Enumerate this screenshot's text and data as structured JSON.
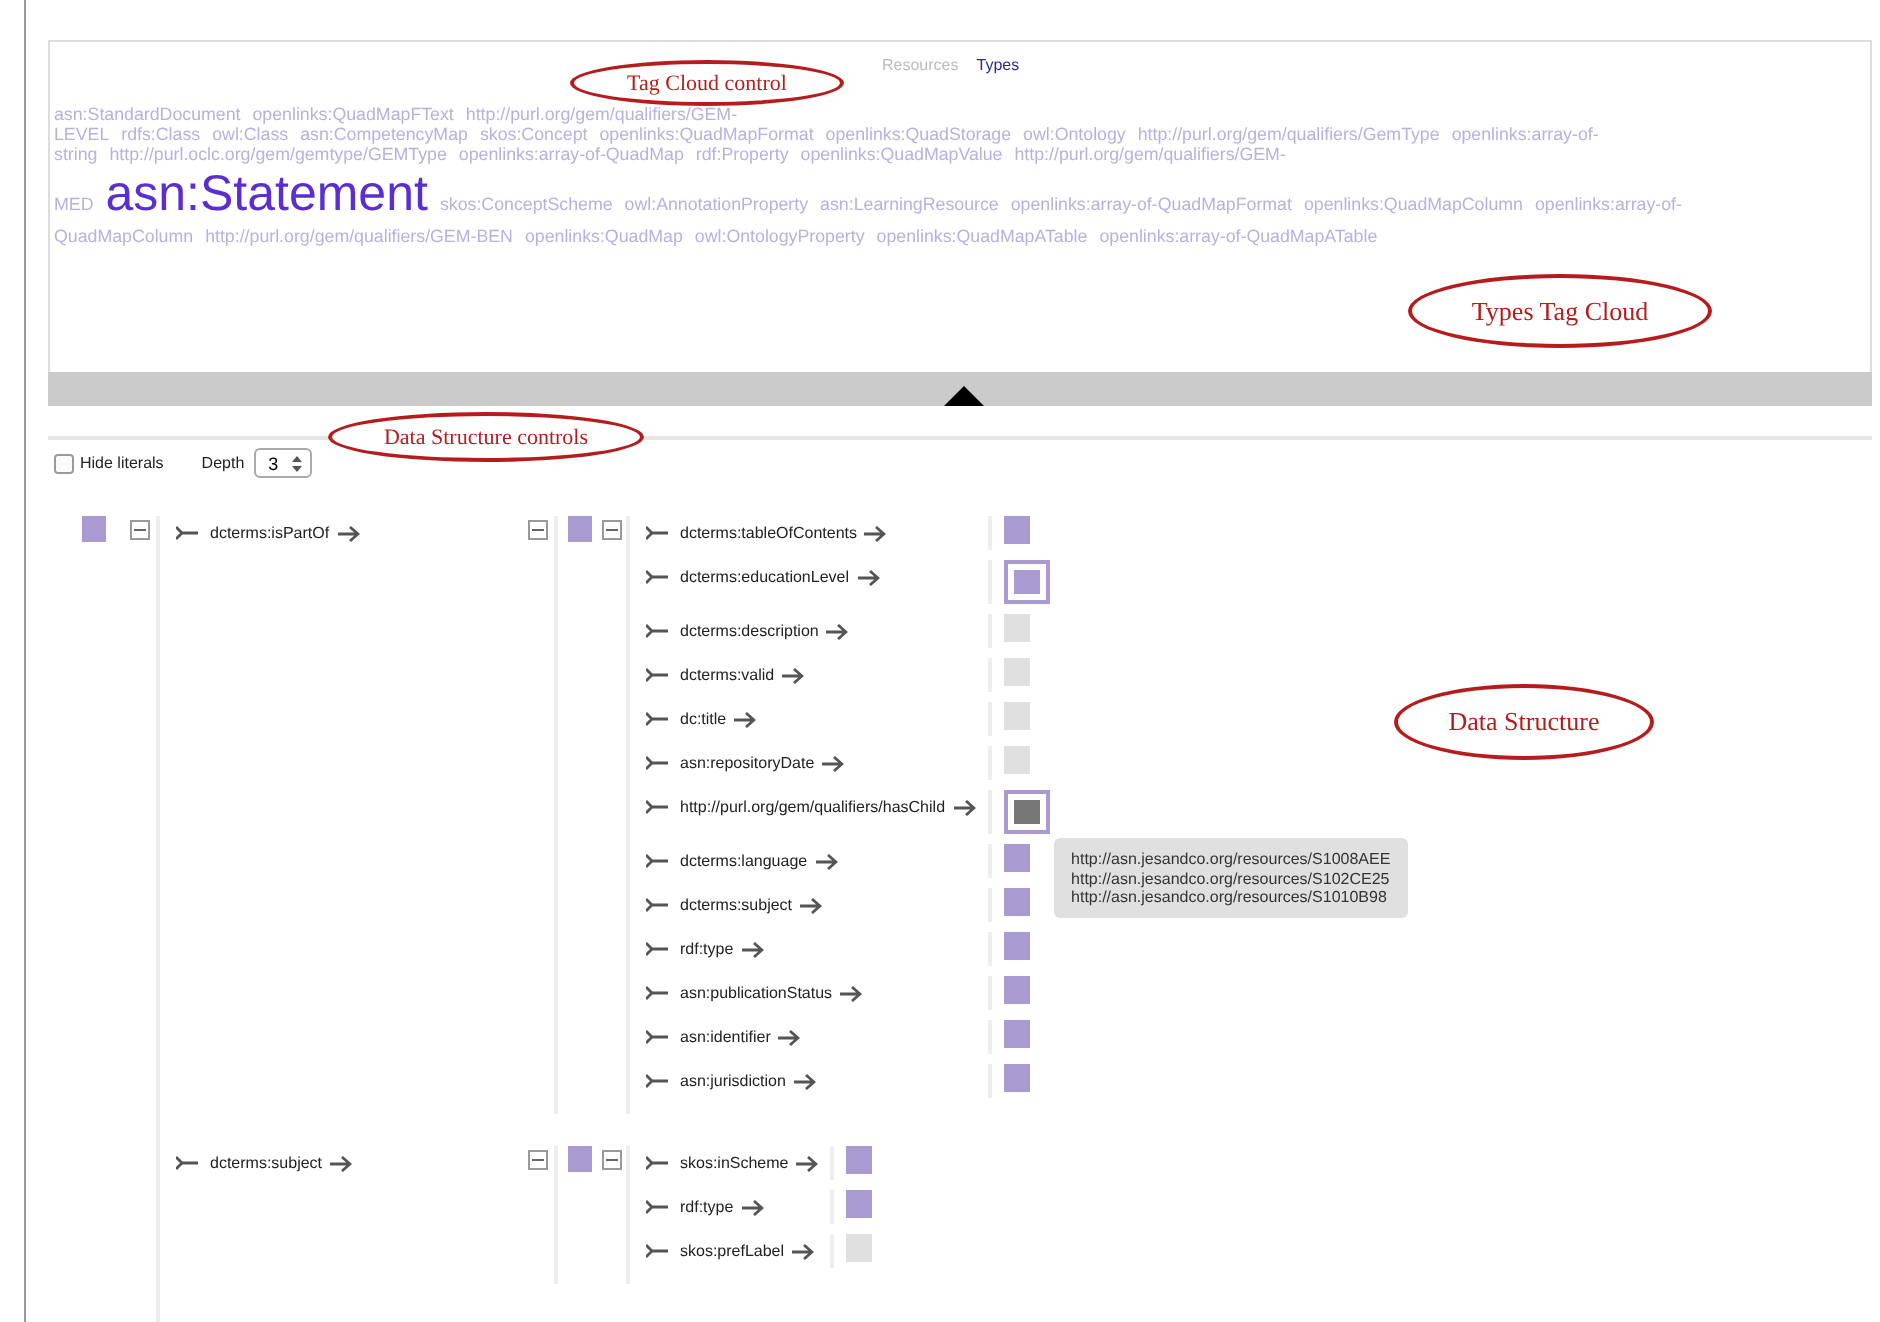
{
  "tabs": [
    {
      "label": "Resources",
      "selected": false
    },
    {
      "label": "Types",
      "selected": true
    }
  ],
  "tag_cloud": [
    [
      {
        "label": "asn:StandardDocument",
        "kind": "normal"
      },
      {
        "label": "openlinks:QuadMapFText",
        "kind": "normal"
      },
      {
        "label": "http://purl.org/gem/qualifiers/GEM-",
        "kind": "normal"
      }
    ],
    [
      {
        "label": "LEVEL",
        "kind": "normal"
      },
      {
        "label": "rdfs:Class",
        "kind": "normal"
      },
      {
        "label": "owl:Class",
        "kind": "normal"
      },
      {
        "label": "asn:CompetencyMap",
        "kind": "normal"
      },
      {
        "label": "skos:Concept",
        "kind": "normal"
      },
      {
        "label": "openlinks:QuadMapFormat",
        "kind": "normal"
      },
      {
        "label": "openlinks:QuadStorage",
        "kind": "normal"
      },
      {
        "label": "owl:Ontology",
        "kind": "normal"
      },
      {
        "label": "http://purl.org/gem/qualifiers/GemType",
        "kind": "normal"
      },
      {
        "label": "openlinks:array-of-",
        "kind": "normal"
      }
    ],
    [
      {
        "label": "string",
        "kind": "normal"
      },
      {
        "label": "http://purl.oclc.org/gem/gemtype/GEMType",
        "kind": "normal"
      },
      {
        "label": "openlinks:array-of-QuadMap",
        "kind": "normal"
      },
      {
        "label": "rdf:Property",
        "kind": "normal"
      },
      {
        "label": "openlinks:QuadMapValue",
        "kind": "normal"
      },
      {
        "label": "http://purl.org/gem/qualifiers/GEM-",
        "kind": "normal"
      }
    ],
    [
      {
        "label": "MED",
        "kind": "normal"
      },
      {
        "label": "asn:Statement",
        "kind": "featured"
      },
      {
        "label": "skos:ConceptScheme",
        "kind": "normal"
      },
      {
        "label": "owl:AnnotationProperty",
        "kind": "normal"
      },
      {
        "label": "asn:LearningResource",
        "kind": "normal"
      },
      {
        "label": "openlinks:array-of-QuadMapFormat",
        "kind": "normal"
      },
      {
        "label": "openlinks:QuadMapColumn",
        "kind": "normal"
      },
      {
        "label": "openlinks:array-of-",
        "kind": "normal"
      }
    ],
    [
      {
        "label": "QuadMapColumn",
        "kind": "normal"
      },
      {
        "label": "http://purl.org/gem/qualifiers/GEM-BEN",
        "kind": "normal"
      },
      {
        "label": "openlinks:QuadMap",
        "kind": "normal"
      },
      {
        "label": "owl:OntologyProperty",
        "kind": "normal"
      },
      {
        "label": "openlinks:QuadMapATable",
        "kind": "normal"
      },
      {
        "label": "openlinks:array-of-QuadMapATable",
        "kind": "normal"
      }
    ]
  ],
  "controls": {
    "hide_literals": {
      "label": "Hide literals",
      "checked": false
    },
    "depth": {
      "label": "Depth",
      "value": "3"
    }
  },
  "tree": {
    "expanded": true,
    "properties": [
      {
        "predicate": "dcterms:isPartOf",
        "expanded": true,
        "object": {
          "expanded": true,
          "properties": [
            {
              "predicate": "dcterms:tableOfContents",
              "value": {
                "kind": "resource",
                "selected": false
              }
            },
            {
              "predicate": "dcterms:educationLevel",
              "value": {
                "kind": "resource",
                "selected": true
              }
            },
            {
              "predicate": "dcterms:description",
              "value": {
                "kind": "literal",
                "selected": false
              }
            },
            {
              "predicate": "dcterms:valid",
              "value": {
                "kind": "literal",
                "selected": false
              }
            },
            {
              "predicate": "dc:title",
              "value": {
                "kind": "literal",
                "selected": false
              }
            },
            {
              "predicate": "asn:repositoryDate",
              "value": {
                "kind": "literal",
                "selected": false
              }
            },
            {
              "predicate": "http://purl.org/gem/qualifiers/hasChild",
              "value": {
                "kind": "collection",
                "selected": true,
                "tooltip": [
                  "http://asn.jesandco.org/resources/S1008AEE",
                  "http://asn.jesandco.org/resources/S102CE25",
                  "http://asn.jesandco.org/resources/S1010B98"
                ]
              }
            },
            {
              "predicate": "dcterms:language",
              "value": {
                "kind": "resource",
                "selected": false
              }
            },
            {
              "predicate": "dcterms:subject",
              "value": {
                "kind": "resource",
                "selected": false
              }
            },
            {
              "predicate": "rdf:type",
              "value": {
                "kind": "resource",
                "selected": false
              }
            },
            {
              "predicate": "asn:publicationStatus",
              "value": {
                "kind": "resource",
                "selected": false
              }
            },
            {
              "predicate": "asn:identifier",
              "value": {
                "kind": "resource",
                "selected": false
              }
            },
            {
              "predicate": "asn:jurisdiction",
              "value": {
                "kind": "resource",
                "selected": false
              }
            }
          ]
        }
      },
      {
        "predicate": "dcterms:subject",
        "expanded": true,
        "object": {
          "expanded": true,
          "properties": [
            {
              "predicate": "skos:inScheme",
              "value": {
                "kind": "resource",
                "selected": false
              }
            },
            {
              "predicate": "rdf:type",
              "value": {
                "kind": "resource",
                "selected": false
              }
            },
            {
              "predicate": "skos:prefLabel",
              "value": {
                "kind": "literal",
                "selected": false
              }
            }
          ]
        }
      }
    ]
  },
  "callouts": [
    {
      "label": "Tag Cloud control"
    },
    {
      "label": "Types Tag Cloud"
    },
    {
      "label": "Data Structure controls"
    },
    {
      "label": "Data Structure"
    }
  ]
}
